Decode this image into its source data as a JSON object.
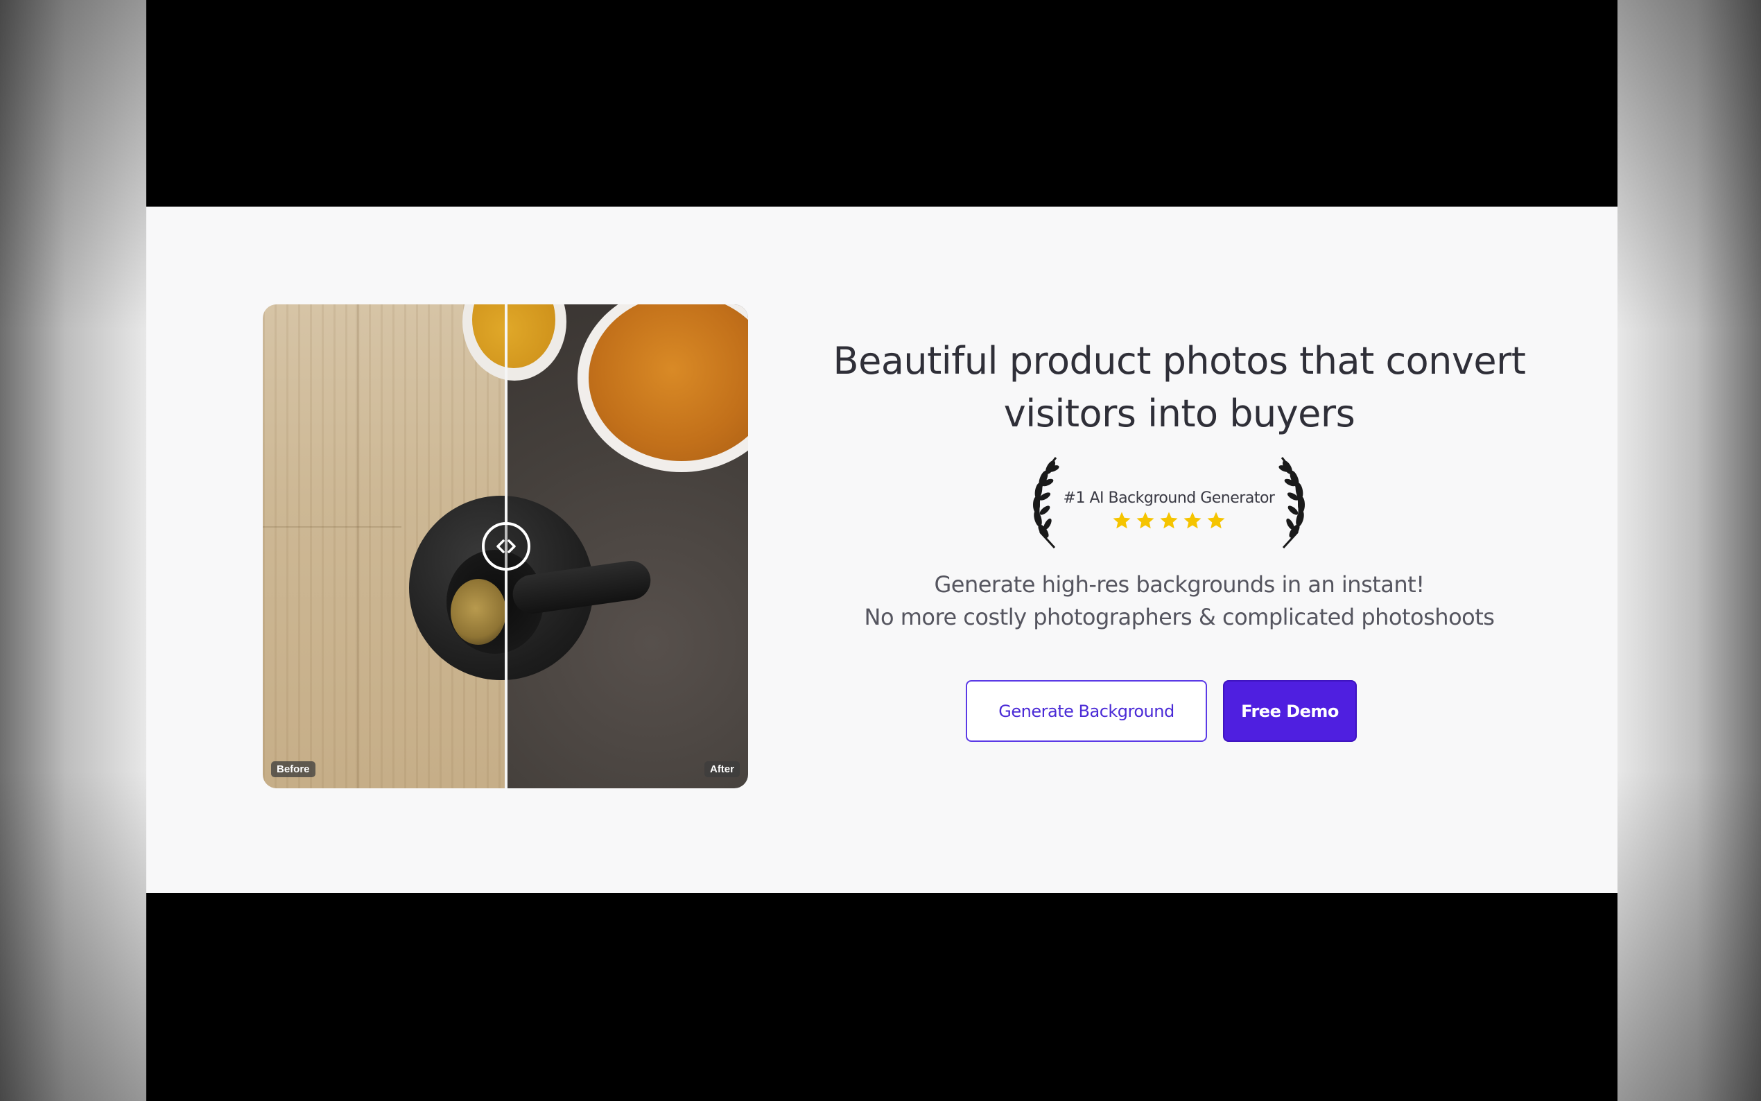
{
  "comparison": {
    "before_label": "Before",
    "after_label": "After"
  },
  "hero": {
    "headline_line1": "Beautiful product photos that convert",
    "headline_line2": "visitors into buyers",
    "award_title": "#1 AI Background Generator",
    "rating_stars": 5,
    "subtext_line1": "Generate high-res backgrounds in an instant!",
    "subtext_line2": "No more costly photographers & complicated photoshoots"
  },
  "actions": {
    "generate_label": "Generate Background",
    "demo_label": "Free Demo"
  },
  "colors": {
    "accent": "#4f1fe0",
    "star": "#f5c400",
    "page_background": "#f8f8f9"
  },
  "icons": {
    "compare_handle": "compare-arrows-icon",
    "laurel": "laurel-wreath-icon",
    "star": "star-icon"
  }
}
